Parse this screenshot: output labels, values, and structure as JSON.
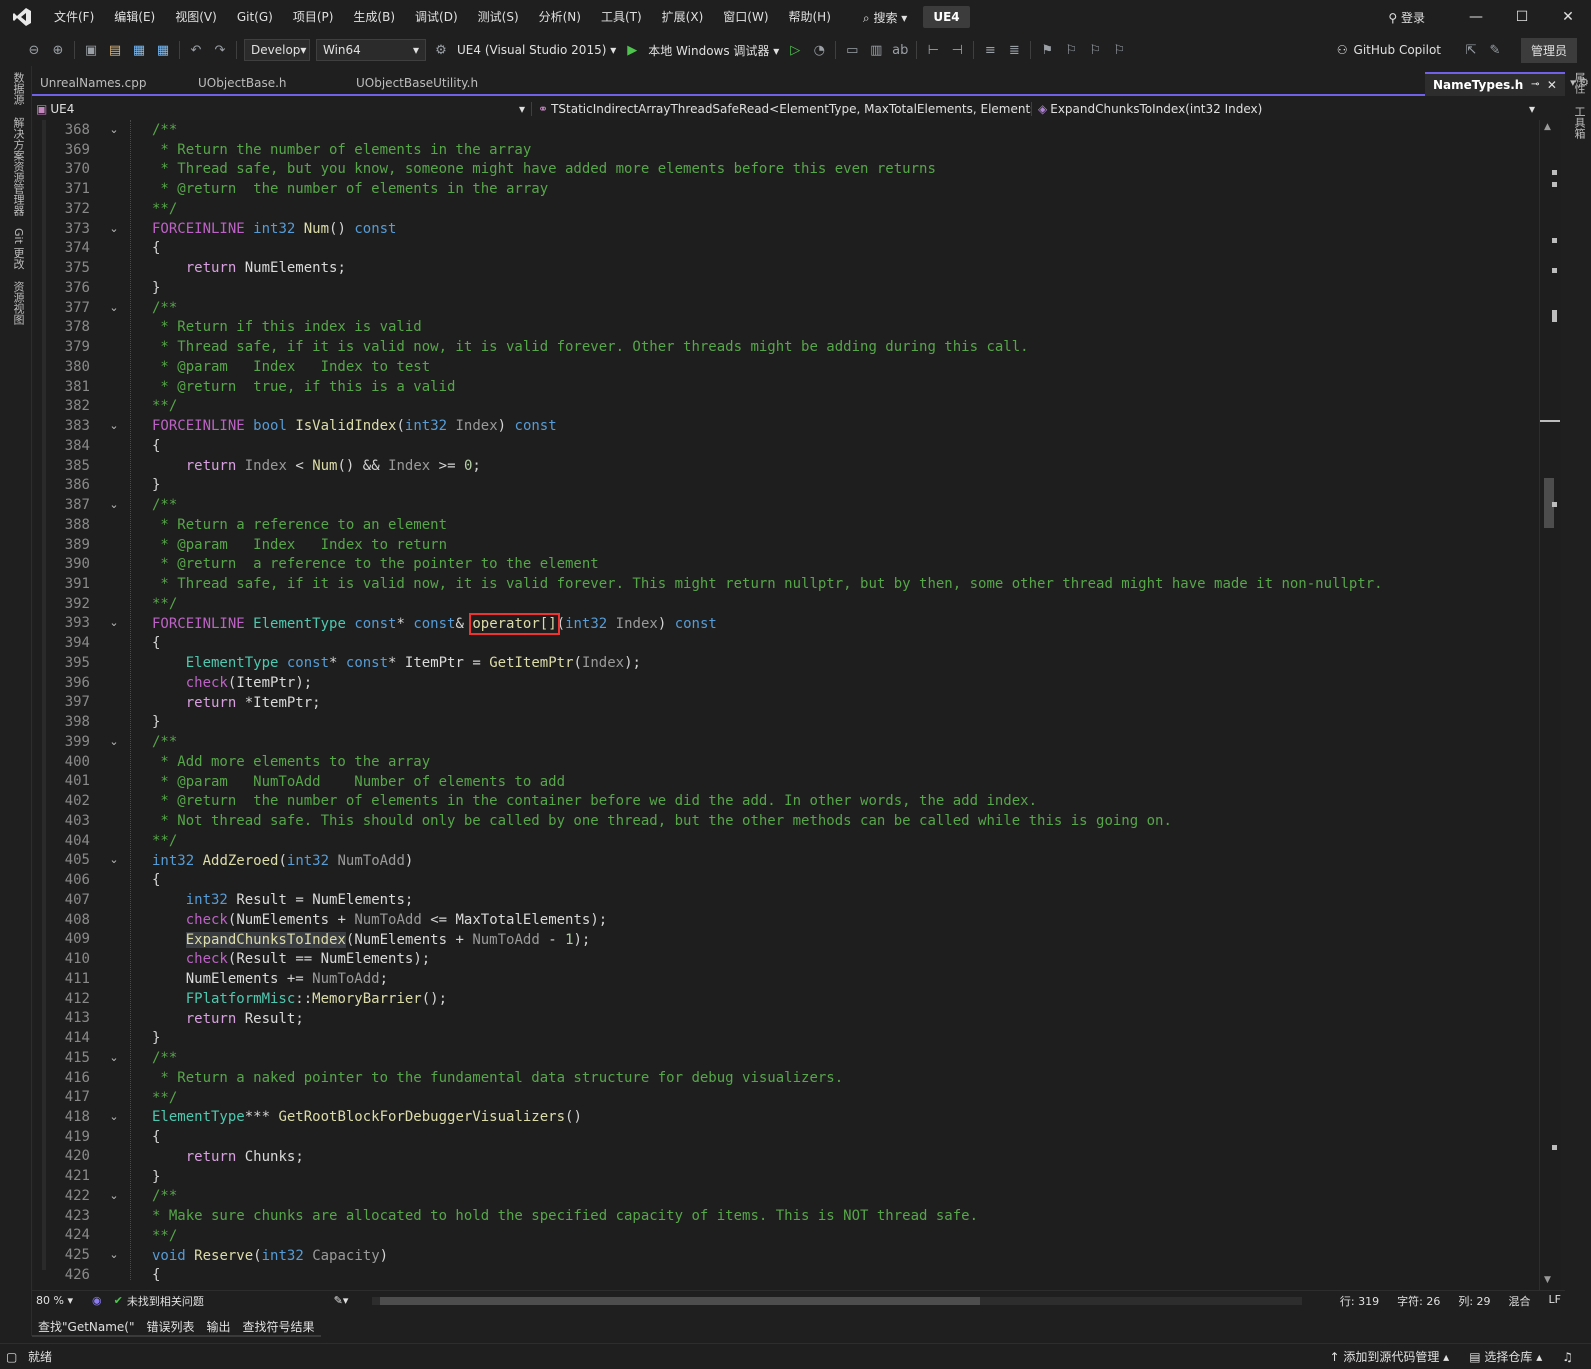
{
  "menubar": {
    "items": [
      "文件(F)",
      "编辑(E)",
      "视图(V)",
      "Git(G)",
      "项目(P)",
      "生成(B)",
      "调试(D)",
      "测试(S)",
      "分析(N)",
      "工具(T)",
      "扩展(X)",
      "窗口(W)",
      "帮助(H)"
    ],
    "search_label": "搜索",
    "solution_badge": "UE4",
    "login_label": "登录"
  },
  "toolbar": {
    "config": "Develop",
    "platform": "Win64",
    "startup_project": "UE4 (Visual Studio 2015)",
    "debugger": "本地 Windows 调试器",
    "copilot": "GitHub Copilot",
    "admin": "管理员"
  },
  "left_rail": [
    "数据源",
    "解决方案资源管理器",
    "Git 更改",
    "资源视图"
  ],
  "right_rail": [
    "属性",
    "工具箱"
  ],
  "doc_tabs": {
    "tabs": [
      "UnrealNames.cpp",
      "UObjectBase.h",
      "UObjectBaseUtility.h"
    ],
    "active": "NameTypes.h"
  },
  "navbar": {
    "project": "UE4",
    "scope": "TStaticIndirectArrayThreadSafeRead<ElementType, MaxTotalElements, Elements",
    "member": "ExpandChunksToIndex(int32 Index)"
  },
  "editor": {
    "lines": [
      {
        "n": "368",
        "fold": true
      },
      {
        "n": "369"
      },
      {
        "n": "370"
      },
      {
        "n": "371"
      },
      {
        "n": "372"
      },
      {
        "n": "373",
        "fold": true
      },
      {
        "n": "374"
      },
      {
        "n": "375"
      },
      {
        "n": "376"
      },
      {
        "n": "377",
        "fold": true
      },
      {
        "n": "378"
      },
      {
        "n": "379"
      },
      {
        "n": "380"
      },
      {
        "n": "381"
      },
      {
        "n": "382"
      },
      {
        "n": "383",
        "fold": true
      },
      {
        "n": "384"
      },
      {
        "n": "385"
      },
      {
        "n": "386"
      },
      {
        "n": "387",
        "fold": true
      },
      {
        "n": "388"
      },
      {
        "n": "389"
      },
      {
        "n": "390"
      },
      {
        "n": "391"
      },
      {
        "n": "392"
      },
      {
        "n": "393",
        "fold": true
      },
      {
        "n": "394"
      },
      {
        "n": "395"
      },
      {
        "n": "396"
      },
      {
        "n": "397"
      },
      {
        "n": "398"
      },
      {
        "n": "399",
        "fold": true
      },
      {
        "n": "400"
      },
      {
        "n": "401"
      },
      {
        "n": "402"
      },
      {
        "n": "403"
      },
      {
        "n": "404"
      },
      {
        "n": "405",
        "fold": true
      },
      {
        "n": "406"
      },
      {
        "n": "407"
      },
      {
        "n": "408"
      },
      {
        "n": "409"
      },
      {
        "n": "410"
      },
      {
        "n": "411"
      },
      {
        "n": "412"
      },
      {
        "n": "413"
      },
      {
        "n": "414"
      },
      {
        "n": "415",
        "fold": true
      },
      {
        "n": "416"
      },
      {
        "n": "417"
      },
      {
        "n": "418",
        "fold": true
      },
      {
        "n": "419"
      },
      {
        "n": "420"
      },
      {
        "n": "421"
      },
      {
        "n": "422",
        "fold": true
      },
      {
        "n": "423"
      },
      {
        "n": "424"
      },
      {
        "n": "425",
        "fold": true
      },
      {
        "n": "426"
      }
    ],
    "code": {
      "l368": "/**",
      "l369": " * Return the number of elements in the array",
      "l370": " * Thread safe, but you know, someone might have added more elements before this even returns",
      "l371": " * @return  the number of elements in the array",
      "l372": "**/",
      "l375_kw": "return",
      "l375_rest": " NumElements;",
      "l377": "/**",
      "l378": " * Return if this index is valid",
      "l379": " * Thread safe, if it is valid now, it is valid forever. Other threads might be adding during this call.",
      "l380": " * @param   Index   Index to test",
      "l381": " * @return  true, if this is a valid",
      "l382": "**/",
      "l387": "/**",
      "l388": " * Return a reference to an element",
      "l389": " * @param   Index   Index to return",
      "l390": " * @return  a reference to the pointer to the element",
      "l391": " * Thread safe, if it is valid now, it is valid forever. This might return nullptr, but by then, some other thread might have made it non-nullptr.",
      "l392": "**/",
      "l393_op": "operator[]",
      "l399": "/**",
      "l400": " * Add more elements to the array",
      "l401": " * @param   NumToAdd    Number of elements to add",
      "l402": " * @return  the number of elements in the container before we did the add. In other words, the add index.",
      "l403": " * Not thread safe. This should only be called by one thread, but the other methods can be called while this is going on.",
      "l404": "**/",
      "l409_fn": "ExpandChunksToIndex",
      "l415": "/**",
      "l416": " * Return a naked pointer to the fundamental data structure for debug visualizers.",
      "l417": "**/",
      "l422": "/**",
      "l423": "* Make sure chunks are allocated to hold the specified capacity of items. This is NOT thread safe.",
      "l424": "**/"
    }
  },
  "editstatus": {
    "zoom": "80 %",
    "issues": "未找到相关问题",
    "line": "行: 319",
    "char": "字符: 26",
    "col": "列: 29",
    "mixed": "混合",
    "eol": "LF"
  },
  "tool_tabs": [
    "查找\"GetName(\"",
    "错误列表",
    "输出",
    "查找符号结果"
  ],
  "statusbar": {
    "ready": "就绪",
    "add_source": "添加到源代码管理",
    "select_repo": "选择仓库"
  },
  "colors": {
    "accent": "#7160e8",
    "comment": "#57a64a",
    "keyword": "#569cd6",
    "type": "#4ec9b0",
    "function": "#dcdcaa",
    "highlight_box": "#e33333"
  }
}
